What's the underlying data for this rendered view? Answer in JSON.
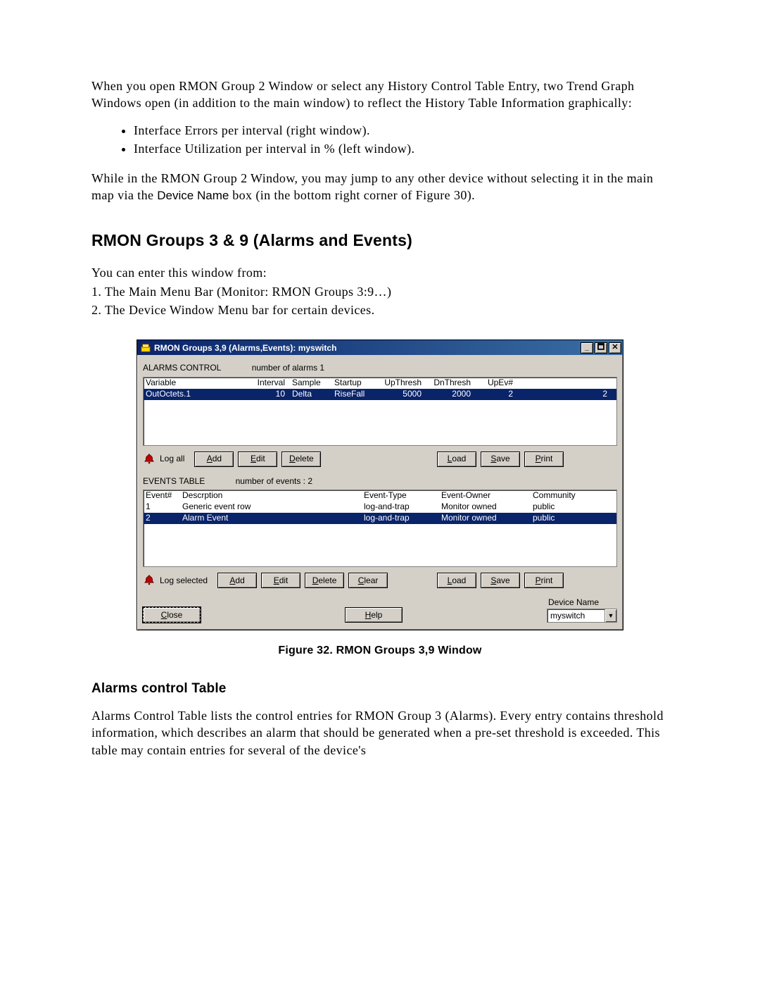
{
  "doc": {
    "intro": "When you open RMON Group 2 Window or select any History Control Table Entry, two Trend Graph Windows open (in addition to the main window) to reflect the History Table Information graphically:",
    "bullets": [
      "Interface Errors per interval (right window).",
      "Interface Utilization per interval in % (left window)."
    ],
    "para2_a": "While in the RMON Group 2 Window, you may jump to any other device without selecting it in the main map via the ",
    "para2_bold": "Device Name",
    "para2_b": " box (in the bottom right corner of Figure 30).",
    "heading": "RMON Groups 3 & 9 (Alarms and Events)",
    "after_heading": [
      "You can enter this window from:",
      "1. The Main Menu Bar (Monitor: RMON Groups 3:9…)",
      "2. The Device Window Menu bar for certain devices."
    ],
    "figure_caption": "Figure 32. RMON Groups 3,9 Window",
    "sub_heading": "Alarms control Table",
    "sub_para": "Alarms Control Table lists the control entries for RMON Group 3 (Alarms). Every entry contains threshold information, which describes an alarm that should be generated when a pre-set threshold is exceeded. This table may contain entries for several of the device's"
  },
  "win": {
    "title": "RMON Groups 3,9 (Alarms,Events): myswitch",
    "alarms": {
      "label": "ALARMS CONTROL",
      "count_label": "number of alarms  1",
      "headers": [
        "Variable",
        "Interval",
        "Sample",
        "Startup",
        "UpThresh",
        "DnThresh",
        "UpEv#",
        ""
      ],
      "row": {
        "variable": "OutOctets.1",
        "interval": "10",
        "sample": "Delta",
        "startup": "RiseFall",
        "up": "5000",
        "dn": "2000",
        "upev": "2",
        "last": "2"
      },
      "log_label": "Log all",
      "buttons_left": [
        "Add",
        "Edit",
        "Delete"
      ],
      "buttons_right": [
        "Load",
        "Save",
        "Print"
      ]
    },
    "events": {
      "label": "EVENTS TABLE",
      "count_label": "number of events :  2",
      "headers": [
        "Event#",
        "Descrption",
        "Event-Type",
        "Event-Owner",
        "Community"
      ],
      "rows": [
        {
          "n": "1",
          "desc": "Generic event row",
          "type": "log-and-trap",
          "owner": "Monitor owned",
          "comm": "public"
        },
        {
          "n": "2",
          "desc": "Alarm Event",
          "type": "log-and-trap",
          "owner": "Monitor owned",
          "comm": "public"
        }
      ],
      "log_label": "Log selected",
      "buttons_left": [
        "Add",
        "Edit",
        "Delete",
        "Clear"
      ],
      "buttons_right": [
        "Load",
        "Save",
        "Print"
      ]
    },
    "bottom": {
      "close": "Close",
      "help": "Help",
      "device_label": "Device Name",
      "device_value": "myswitch"
    }
  }
}
